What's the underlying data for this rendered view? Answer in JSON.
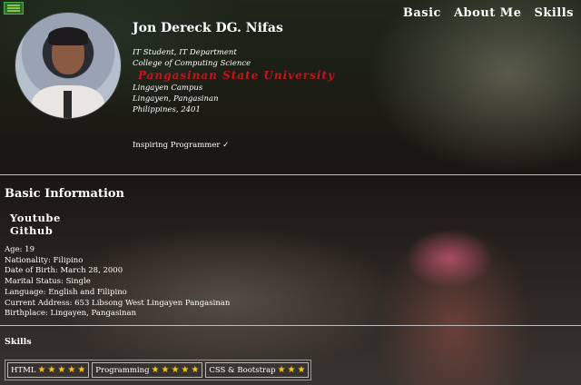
{
  "nav": {
    "items": [
      "Basic",
      "About Me",
      "Skills"
    ]
  },
  "profile": {
    "name": "Jon Dereck DG. Nifas",
    "lines": [
      "IT Student, IT Department",
      "College of Computing Science"
    ],
    "university": "Pangasinan State University",
    "address_lines": [
      "Lingayen Campus",
      "Lingayen, Pangasinan",
      "Philippines, 2401"
    ],
    "tagline": "Inspiring Programmer ✓"
  },
  "basic": {
    "title": "Basic Information",
    "links": [
      "Youtube",
      "Github"
    ],
    "details": [
      "Age: 19",
      "Nationality: Filipino",
      "Date of Birth: March 28, 2000",
      "Marital Status: Single",
      "Language: English and Filipino",
      "Current Address: 653 Libsong West Lingayen Pangasinan",
      "Birthplace: Lingayen, Pangasinan"
    ]
  },
  "skills": {
    "title": "Skills",
    "items": [
      {
        "name": "HTML",
        "stars": 5
      },
      {
        "name": "Programming",
        "stars": 5
      },
      {
        "name": "CSS & Bootstrap",
        "stars": 3
      }
    ]
  },
  "colors": {
    "accent_green": "#4caf50",
    "university_red": "#c8141c",
    "star": "#f5c518"
  }
}
